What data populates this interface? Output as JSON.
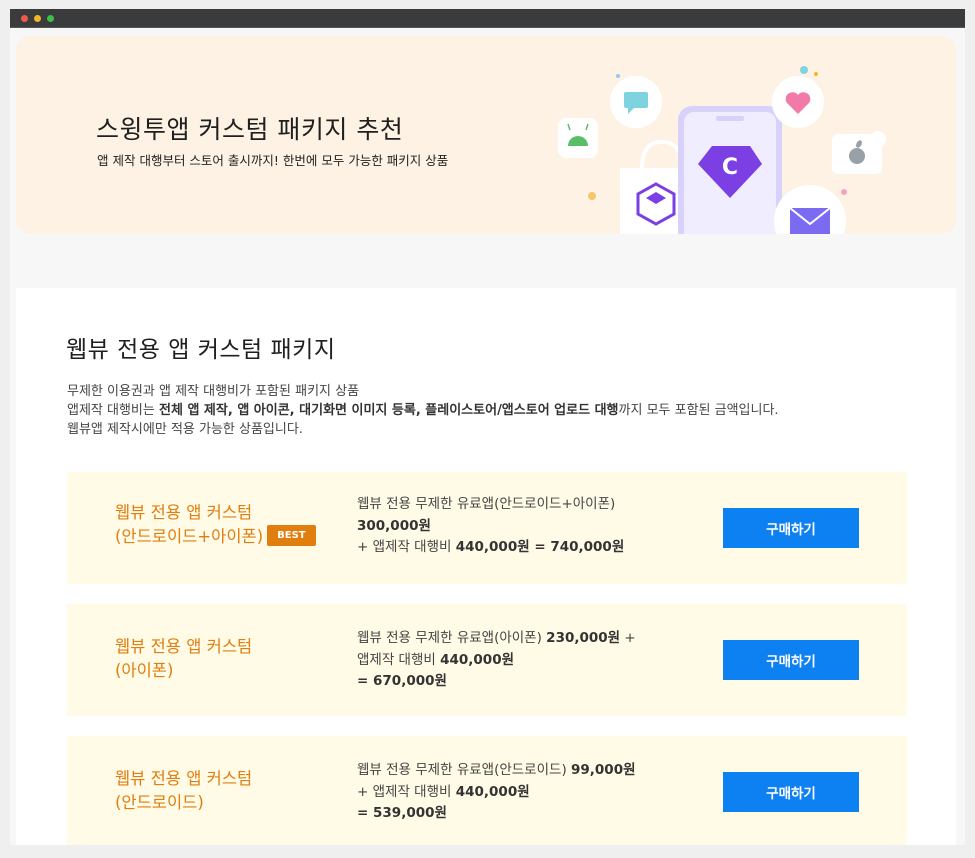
{
  "banner": {
    "title": "스윙투앱 커스텀 패키지 추천",
    "subtitle": "앱 제작 대행부터 스토어 출시까지! 한번에 모두 가능한 패키지 상품",
    "icon_badge_letter": "C"
  },
  "section": {
    "title": "웹뷰 전용 앱 커스텀 패키지",
    "desc_line1": "무제한 이용권과 앱 제작 대행비가 포함된 패키지 상품",
    "desc_line2_pre": "앱제작 대행비는 ",
    "desc_line2_bold": "전체 앱 제작, 앱 아이콘, 대기화면 이미지 등록, 플레이스토어/앱스토어 업로드 대행",
    "desc_line2_post": "까지 모두 포함된 금액입니다.",
    "desc_line3": "웹뷰앱 제작시에만 적용 가능한 상품입니다."
  },
  "packages": [
    {
      "name_line1": "웹뷰 전용 앱 커스텀",
      "name_line2": "(안드로이드+아이폰)",
      "badge": "BEST",
      "detail_l1_text": "웹뷰 전용 무제한 유료앱(안드로이드+아이폰)",
      "detail_l2_bold": "300,000원",
      "detail_l3_text": "+ 앱제작 대행비 ",
      "detail_l3_bold": "440,000원 = 740,000원",
      "button_label": "구매하기"
    },
    {
      "name_line1": "웹뷰 전용 앱 커스텀",
      "name_line2": "(아이폰)",
      "detail_l1_text": "웹뷰 전용 무제한 유료앱(아이폰) ",
      "detail_l1_bold": "230,000원",
      "detail_l1_tail": " +",
      "detail_l2_text": "앱제작 대행비 ",
      "detail_l2_bold": "440,000원",
      "detail_l3_bold": "= 670,000원",
      "button_label": "구매하기"
    },
    {
      "name_line1": "웹뷰 전용 앱 커스텀",
      "name_line2": "(안드로이드)",
      "detail_l1_text": "웹뷰 전용 무제한 유료앱(안드로이드) ",
      "detail_l1_bold": "99,000원",
      "detail_l2_text": "+ 앱제작 대행비 ",
      "detail_l2_bold": "440,000원",
      "detail_l3_bold": "= 539,000원",
      "button_label": "구매하기"
    }
  ],
  "colors": {
    "accent_orange": "#e07e10",
    "button_blue": "#0d80f2",
    "card_bg": "#fffbe6",
    "banner_bg": "#fdf2e3",
    "phone_purple": "#7b3fe4"
  }
}
